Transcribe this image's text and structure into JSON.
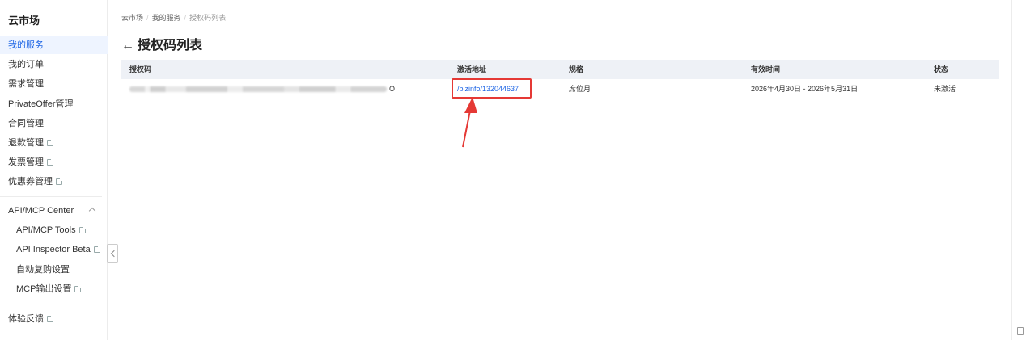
{
  "sidebar": {
    "brand": "云市场",
    "items": [
      {
        "label": "我的服务",
        "active": true
      },
      {
        "label": "我的订单"
      },
      {
        "label": "需求管理"
      },
      {
        "label": "PrivateOffer管理"
      },
      {
        "label": "合同管理"
      },
      {
        "label": "退款管理",
        "external": true
      },
      {
        "label": "发票管理",
        "external": true
      },
      {
        "label": "优惠券管理",
        "external": true
      }
    ],
    "group": {
      "label": "API/MCP Center",
      "items": [
        {
          "label": "API/MCP Tools",
          "external": true
        },
        {
          "label": "API Inspector Beta",
          "external": true
        },
        {
          "label": "自动复购设置"
        },
        {
          "label": "MCP输出设置",
          "external": true
        }
      ]
    },
    "feedback": {
      "label": "体验反馈",
      "external": true
    }
  },
  "breadcrumb": [
    "云市场",
    "我的服务",
    "授权码列表"
  ],
  "page": {
    "title": "授权码列表"
  },
  "table": {
    "headers": [
      "授权码",
      "激活地址",
      "规格",
      "有效时间",
      "状态"
    ],
    "rows": [
      {
        "code_tail": "O",
        "activation": "/bizinfo/132044637",
        "spec": "席位月",
        "valid": "2026年4月30日 - 2026年5月31日",
        "status": "未激活"
      }
    ]
  },
  "colors": {
    "accent": "#1f66e5",
    "annotation": "#e53935",
    "header_bg": "#eef1f6",
    "active_bg": "#eef4ff"
  }
}
